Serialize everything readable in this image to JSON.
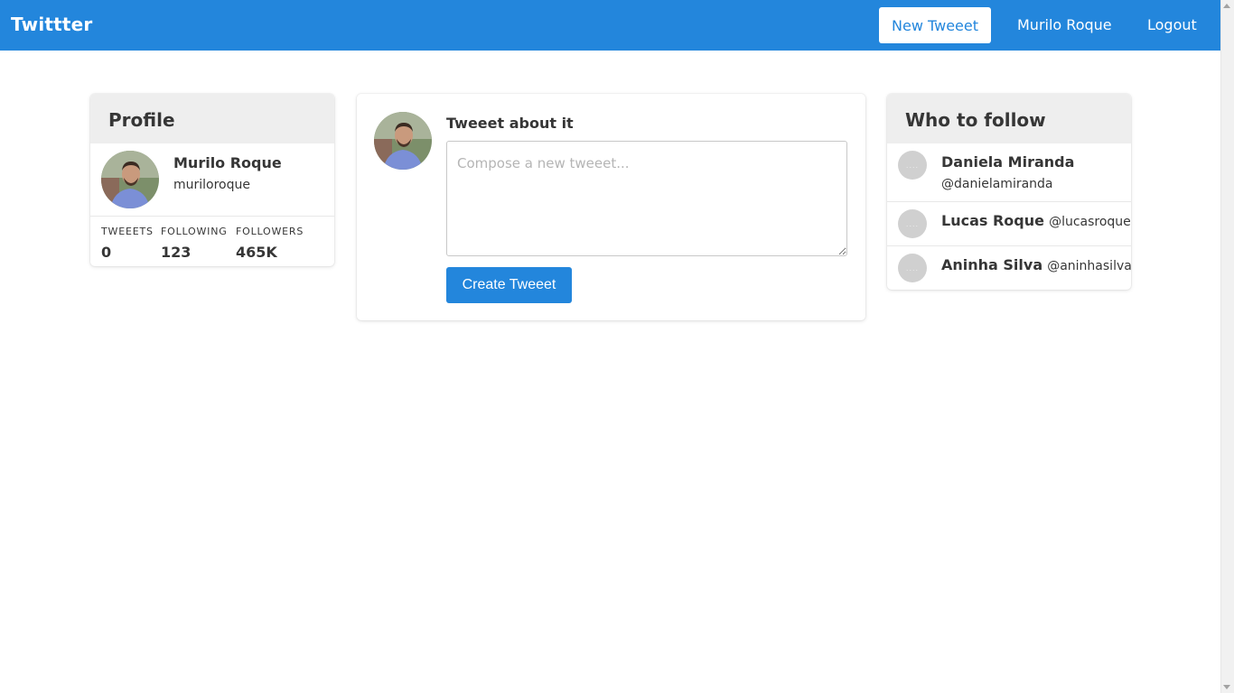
{
  "navbar": {
    "brand": "Twittter",
    "new_tweet_label": "New Tweeet",
    "user_label": "Murilo Roque",
    "logout_label": "Logout"
  },
  "profile": {
    "header": "Profile",
    "name": "Murilo Roque",
    "handle": "muriloroque",
    "stats": [
      {
        "label": "TWEEETS",
        "value": "0"
      },
      {
        "label": "FOLLOWING",
        "value": "123"
      },
      {
        "label": "FOLLOWERS",
        "value": "465K"
      }
    ]
  },
  "compose": {
    "title": "Tweeet about it",
    "placeholder": "Compose a new tweeet...",
    "submit_label": "Create Tweeet"
  },
  "who_to_follow": {
    "header": "Who to follow",
    "items": [
      {
        "name": "Daniela Miranda",
        "handle": "@danielamiranda"
      },
      {
        "name": "Lucas Roque",
        "handle": "@lucasroque"
      },
      {
        "name": "Aninha Silva",
        "handle": "@aninhasilva"
      }
    ],
    "avatar_placeholder": "...."
  },
  "colors": {
    "primary": "#2386dc",
    "header_bg": "#eeeeee",
    "text": "#363636"
  }
}
